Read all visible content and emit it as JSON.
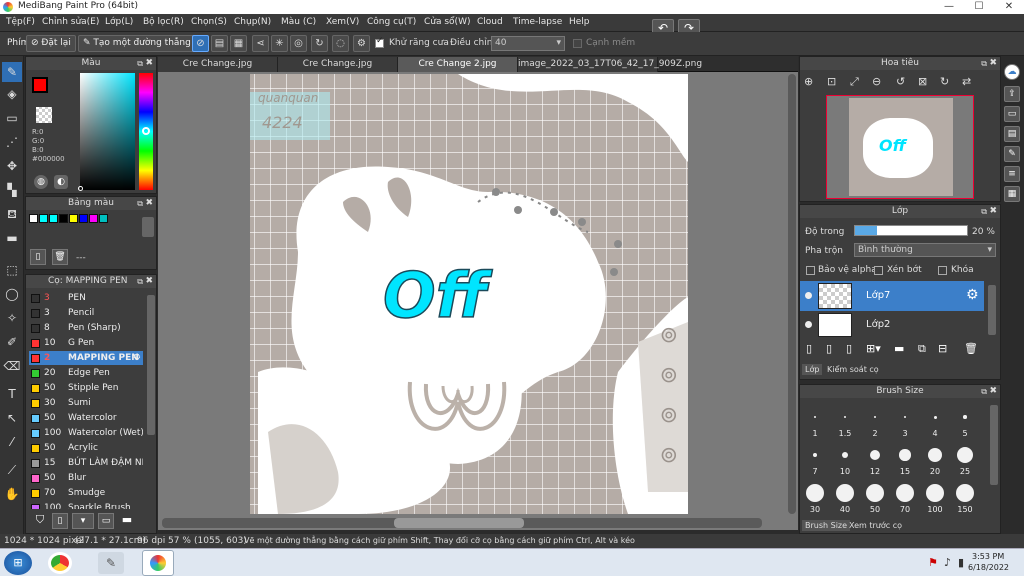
{
  "app": {
    "title": "MediBang Paint Pro (64bit)"
  },
  "menu": [
    "Tệp(F)",
    "Chỉnh sửa(E)",
    "Lớp(L)",
    "Bộ lọc(R)",
    "Chọn(S)",
    "Chụp(N)",
    "Màu (C)",
    "Xem(V)",
    "Công cụ(T)",
    "Cửa sổ(W)",
    "Cloud",
    "Time-lapse",
    "Help"
  ],
  "toolbar": {
    "brush_label": "Phím",
    "reset_label": "Đặt lại",
    "line_label": "Tạo một đường thẳng",
    "antialias_label": "Khử răng cưa",
    "adjust_label": "Điều chỉnh",
    "adjust_value": "40",
    "smooth_label": "Cạnh mềm"
  },
  "color_panel": {
    "title": "Màu",
    "r": "R:0",
    "g": "G:0",
    "b": "B:0",
    "hex": "#000000",
    "primary": "#ff0000",
    "secondary": "#000000"
  },
  "palette_panel": {
    "title": "Bảng màu",
    "swatches": [
      "#ffffff",
      "#00ffff",
      "#00ffff",
      "#000000",
      "#ffff00",
      "#0000ff",
      "#ff00ff",
      "#00bfbf"
    ],
    "more": "---"
  },
  "brush_panel": {
    "title": "Cọ: MAPPING PEN",
    "brushes": [
      {
        "size": "3",
        "name": "PEN",
        "color": "#333333",
        "red": true
      },
      {
        "size": "3",
        "name": "Pencil",
        "color": "#333333",
        "red": false
      },
      {
        "size": "8",
        "name": "Pen (Sharp)",
        "color": "#333333",
        "red": false
      },
      {
        "size": "10",
        "name": "G Pen",
        "color": "#ff3333",
        "red": false
      },
      {
        "size": "2",
        "name": "MAPPING PEN",
        "color": "#ff3333",
        "red": true,
        "selected": true
      },
      {
        "size": "20",
        "name": "Edge Pen",
        "color": "#33cc33",
        "red": false
      },
      {
        "size": "50",
        "name": "Stipple Pen",
        "color": "#ffcc00",
        "red": false
      },
      {
        "size": "30",
        "name": "Sumi",
        "color": "#ffcc00",
        "red": false
      },
      {
        "size": "50",
        "name": "Watercolor",
        "color": "#66ccff",
        "red": false
      },
      {
        "size": "100",
        "name": "Watercolor (Wet)",
        "color": "#66ccff",
        "red": false
      },
      {
        "size": "50",
        "name": "Acrylic",
        "color": "#ffcc00",
        "red": false
      },
      {
        "size": "15",
        "name": "BÚT LÀM ĐẬM NÉT",
        "color": "#999999",
        "red": false
      },
      {
        "size": "50",
        "name": "Blur",
        "color": "#ff66cc",
        "red": false
      },
      {
        "size": "70",
        "name": "Smudge",
        "color": "#ffcc00",
        "red": false
      },
      {
        "size": "100",
        "name": "Sparkle Brush",
        "color": "#cc66ff",
        "red": false
      }
    ]
  },
  "tabs": [
    {
      "label": "Cre Change.jpg",
      "active": false
    },
    {
      "label": "Cre Change.jpg",
      "active": false
    },
    {
      "label": "Cre Change 2.jpg",
      "active": true
    },
    {
      "label": "image_2022_03_17T06_42_17_909Z.png",
      "active": false
    }
  ],
  "canvas": {
    "text": "Off",
    "watermark1": "quanquan",
    "watermark2": "4224"
  },
  "navigator": {
    "title": "Hoa tiêu"
  },
  "layer_panel": {
    "title": "Lớp",
    "opacity_label": "Độ trong",
    "opacity_value": "20 %",
    "opacity_fraction": 0.2,
    "blend_label": "Pha trộn",
    "blend_value": "Bình thường",
    "protect_alpha": "Bảo vệ alpha",
    "clipping": "Xén bớt",
    "lock": "Khóa",
    "layers": [
      {
        "name": "Lớp7",
        "selected": true
      },
      {
        "name": "Lớp2",
        "selected": false
      }
    ],
    "tab1": "Lớp",
    "tab2": "Kiểm soát cọ"
  },
  "brush_size_panel": {
    "title": "Brush Size",
    "sizes": [
      "1",
      "1.5",
      "2",
      "3",
      "4",
      "5",
      "7",
      "10",
      "12",
      "15",
      "20",
      "25",
      "30",
      "40",
      "50",
      "70",
      "100",
      "150"
    ],
    "tab1": "Brush Size",
    "tab2": "Xem trước cọ"
  },
  "status": {
    "size": "1024 * 1024 pixel",
    "dims": "(27.1 * 27.1cm)",
    "dpi": "96 dpi",
    "zoom": "57 %",
    "coord": "(1055, 603)",
    "hint": "Vẽ một đường thẳng bằng cách giữ phím Shift, Thay đổi cỡ cọ bằng cách giữ phím Ctrl, Alt và kéo"
  },
  "taskbar": {
    "time": "3:53 PM",
    "date": "6/18/2022"
  }
}
